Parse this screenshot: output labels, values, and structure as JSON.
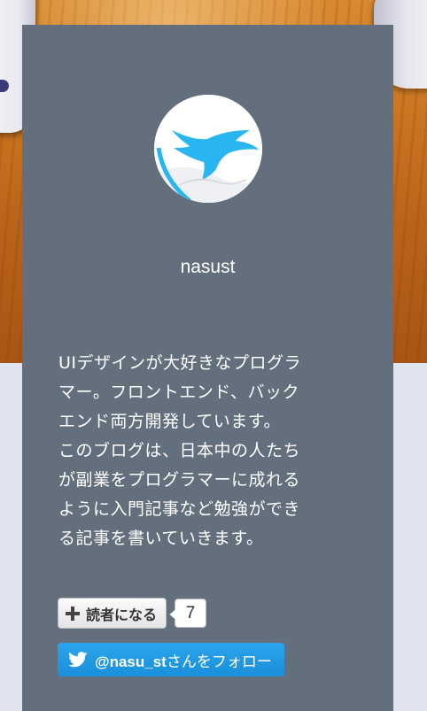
{
  "profile": {
    "username": "nasust",
    "bio_lines": [
      "UIデザインが大好きなプログラ",
      "マー。フロントエンド、バック",
      "エンド両方開発しています。",
      "このブログは、日本中の人たち",
      "が副業をプログラマーに成れる",
      "ように入門記事など勉強ができ",
      "る記事を書いていきます。"
    ]
  },
  "subscribe": {
    "label": "読者になる",
    "count": "7",
    "icon": "plus-icon"
  },
  "twitter": {
    "handle": "@nasu_st",
    "suffix": "さんをフォロー",
    "icon": "twitter-bird-icon",
    "color": "#1d9bf0"
  },
  "colors": {
    "card_background": "#636f7c",
    "page_background": "#dfe4ee",
    "avatar_accent": "#29b6f0"
  }
}
